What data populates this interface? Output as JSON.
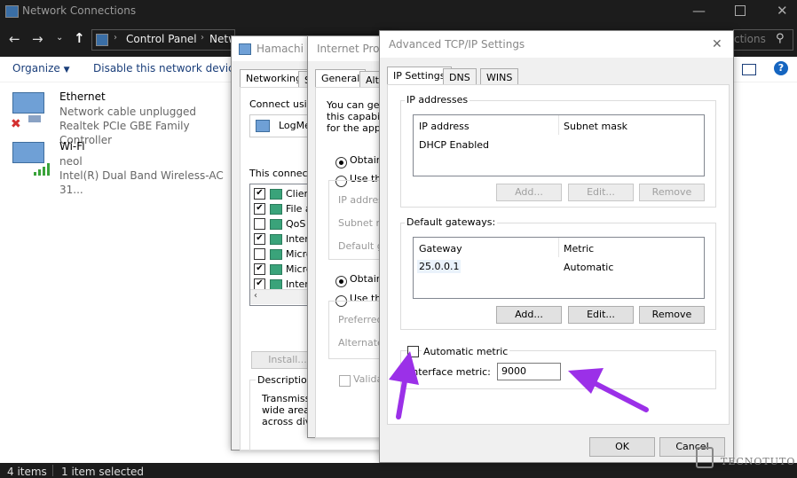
{
  "explorer": {
    "title": "Network Connections",
    "breadcrumb": [
      "Control Panel",
      "Netw"
    ],
    "search_placeholder": "ctions",
    "organize": "Organize",
    "disable_label": "Disable this network device",
    "connections": [
      {
        "name": "Ethernet",
        "status": "Network cable unplugged",
        "adapter": "Realtek PCIe GBE Family Controller"
      },
      {
        "name": "Wi-Fi",
        "status": "neol",
        "adapter": "Intel(R) Dual Band Wireless-AC 31..."
      }
    ],
    "status_items": "4 items",
    "status_selected": "1 item selected"
  },
  "hamachi": {
    "title": "Hamachi P",
    "tabs": [
      "Networking",
      "S"
    ],
    "connect_label": "Connect using",
    "adapter": "LogMe",
    "items_label": "This connectio",
    "items": [
      {
        "label": "Client",
        "checked": true
      },
      {
        "label": "File a",
        "checked": true
      },
      {
        "label": "QoS",
        "checked": false
      },
      {
        "label": "Intern",
        "checked": true
      },
      {
        "label": "Micro",
        "checked": false
      },
      {
        "label": "Micro",
        "checked": true
      },
      {
        "label": "Intern",
        "checked": true
      }
    ],
    "install": "Install...",
    "desc_label": "Description",
    "desc_lines": [
      "Transmission",
      "wide area n",
      "across dive"
    ]
  },
  "ipv4": {
    "title": "Internet Proto",
    "tabs": [
      "General",
      "Alte"
    ],
    "intro": [
      "You can get",
      "this capabili",
      "for the appro"
    ],
    "obtain_ip": "Obtain",
    "use_ip": "Use the",
    "ip_label": "IP address",
    "subnet_label": "Subnet ma",
    "gateway_label": "Default ga",
    "obtain_dns": "Obtain",
    "use_dns": "Use the",
    "preferred": "Preferred",
    "alternate": "Alternate",
    "validate": "Validat"
  },
  "advanced": {
    "title": "Advanced TCP/IP Settings",
    "tabs": [
      "IP Settings",
      "DNS",
      "WINS"
    ],
    "ip_group": "IP addresses",
    "ip_columns": [
      "IP address",
      "Subnet mask"
    ],
    "ip_rows": [
      [
        "DHCP Enabled",
        ""
      ]
    ],
    "ip_buttons": [
      "Add...",
      "Edit...",
      "Remove"
    ],
    "gw_group": "Default gateways:",
    "gw_columns": [
      "Gateway",
      "Metric"
    ],
    "gw_rows": [
      [
        "25.0.0.1",
        "Automatic"
      ]
    ],
    "gw_buttons": [
      "Add...",
      "Edit...",
      "Remove"
    ],
    "auto_metric": "Automatic metric",
    "auto_metric_checked": false,
    "metric_label": "Interface metric:",
    "metric_value": "9000",
    "ok": "OK",
    "cancel": "Cancel"
  },
  "watermark": "TECNOTUTO",
  "colors": {
    "arrow": "#9b30e8",
    "dark_chrome": "#1c1c1c"
  }
}
